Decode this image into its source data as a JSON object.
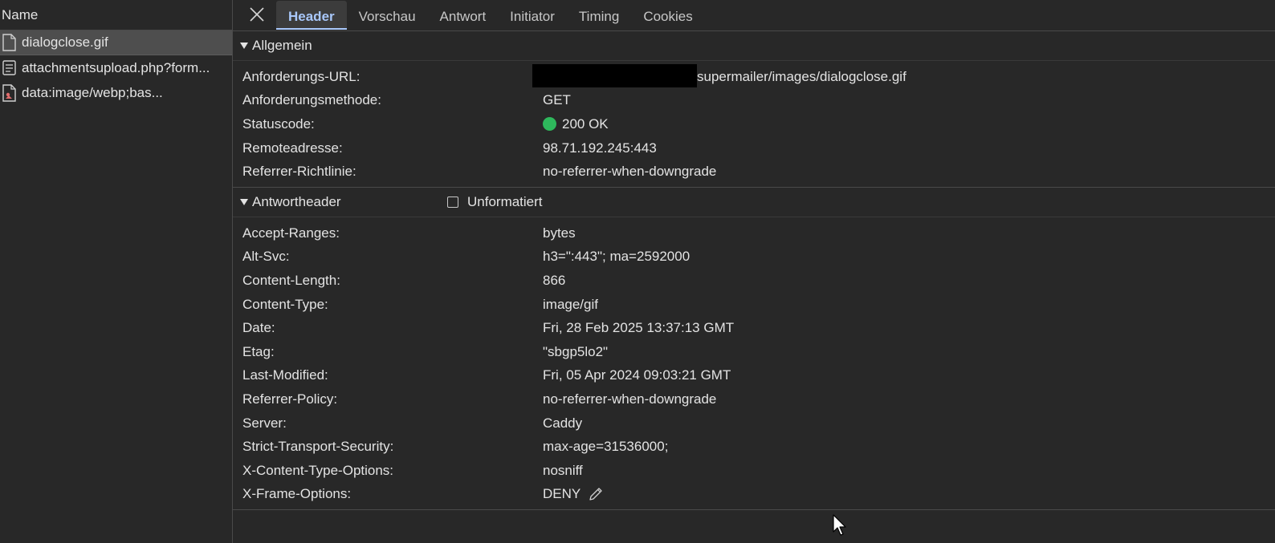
{
  "left_pane": {
    "header": "Name",
    "requests": [
      {
        "label": "dialogclose.gif",
        "icon": "document-icon",
        "selected": true
      },
      {
        "label": "attachmentsupload.php?form...",
        "icon": "page-list-icon",
        "selected": false
      },
      {
        "label": "data:image/webp;bas...",
        "icon": "image-file-icon",
        "selected": false
      }
    ]
  },
  "tabs": [
    "Header",
    "Vorschau",
    "Antwort",
    "Initiator",
    "Timing",
    "Cookies"
  ],
  "active_tab": "Header",
  "general": {
    "title": "Allgemein",
    "rows": [
      {
        "key": "Anforderungs-URL:",
        "value": "supermailer/images/dialogclose.gif"
      },
      {
        "key": "Anforderungsmethode:",
        "value": "GET"
      },
      {
        "key": "Statuscode:",
        "value": "200 OK"
      },
      {
        "key": "Remoteadresse:",
        "value": "98.71.192.245:443"
      },
      {
        "key": "Referrer-Richtlinie:",
        "value": "no-referrer-when-downgrade"
      }
    ]
  },
  "response_headers": {
    "title": "Antwortheader",
    "raw_label": "Unformatiert",
    "rows": [
      {
        "key": "Accept-Ranges:",
        "value": "bytes"
      },
      {
        "key": "Alt-Svc:",
        "value": "h3=\":443\"; ma=2592000"
      },
      {
        "key": "Content-Length:",
        "value": "866"
      },
      {
        "key": "Content-Type:",
        "value": "image/gif"
      },
      {
        "key": "Date:",
        "value": "Fri, 28 Feb 2025 13:37:13 GMT"
      },
      {
        "key": "Etag:",
        "value": "\"sbgp5lo2\""
      },
      {
        "key": "Last-Modified:",
        "value": "Fri, 05 Apr 2024 09:03:21 GMT"
      },
      {
        "key": "Referrer-Policy:",
        "value": "no-referrer-when-downgrade"
      },
      {
        "key": "Server:",
        "value": "Caddy"
      },
      {
        "key": "Strict-Transport-Security:",
        "value": "max-age=31536000;"
      },
      {
        "key": "X-Content-Type-Options:",
        "value": "nosniff"
      },
      {
        "key": "X-Frame-Options:",
        "value": "DENY"
      }
    ]
  },
  "colors": {
    "background": "#282828",
    "accent": "#a8c7fa",
    "status_ok": "#2eb85c"
  }
}
